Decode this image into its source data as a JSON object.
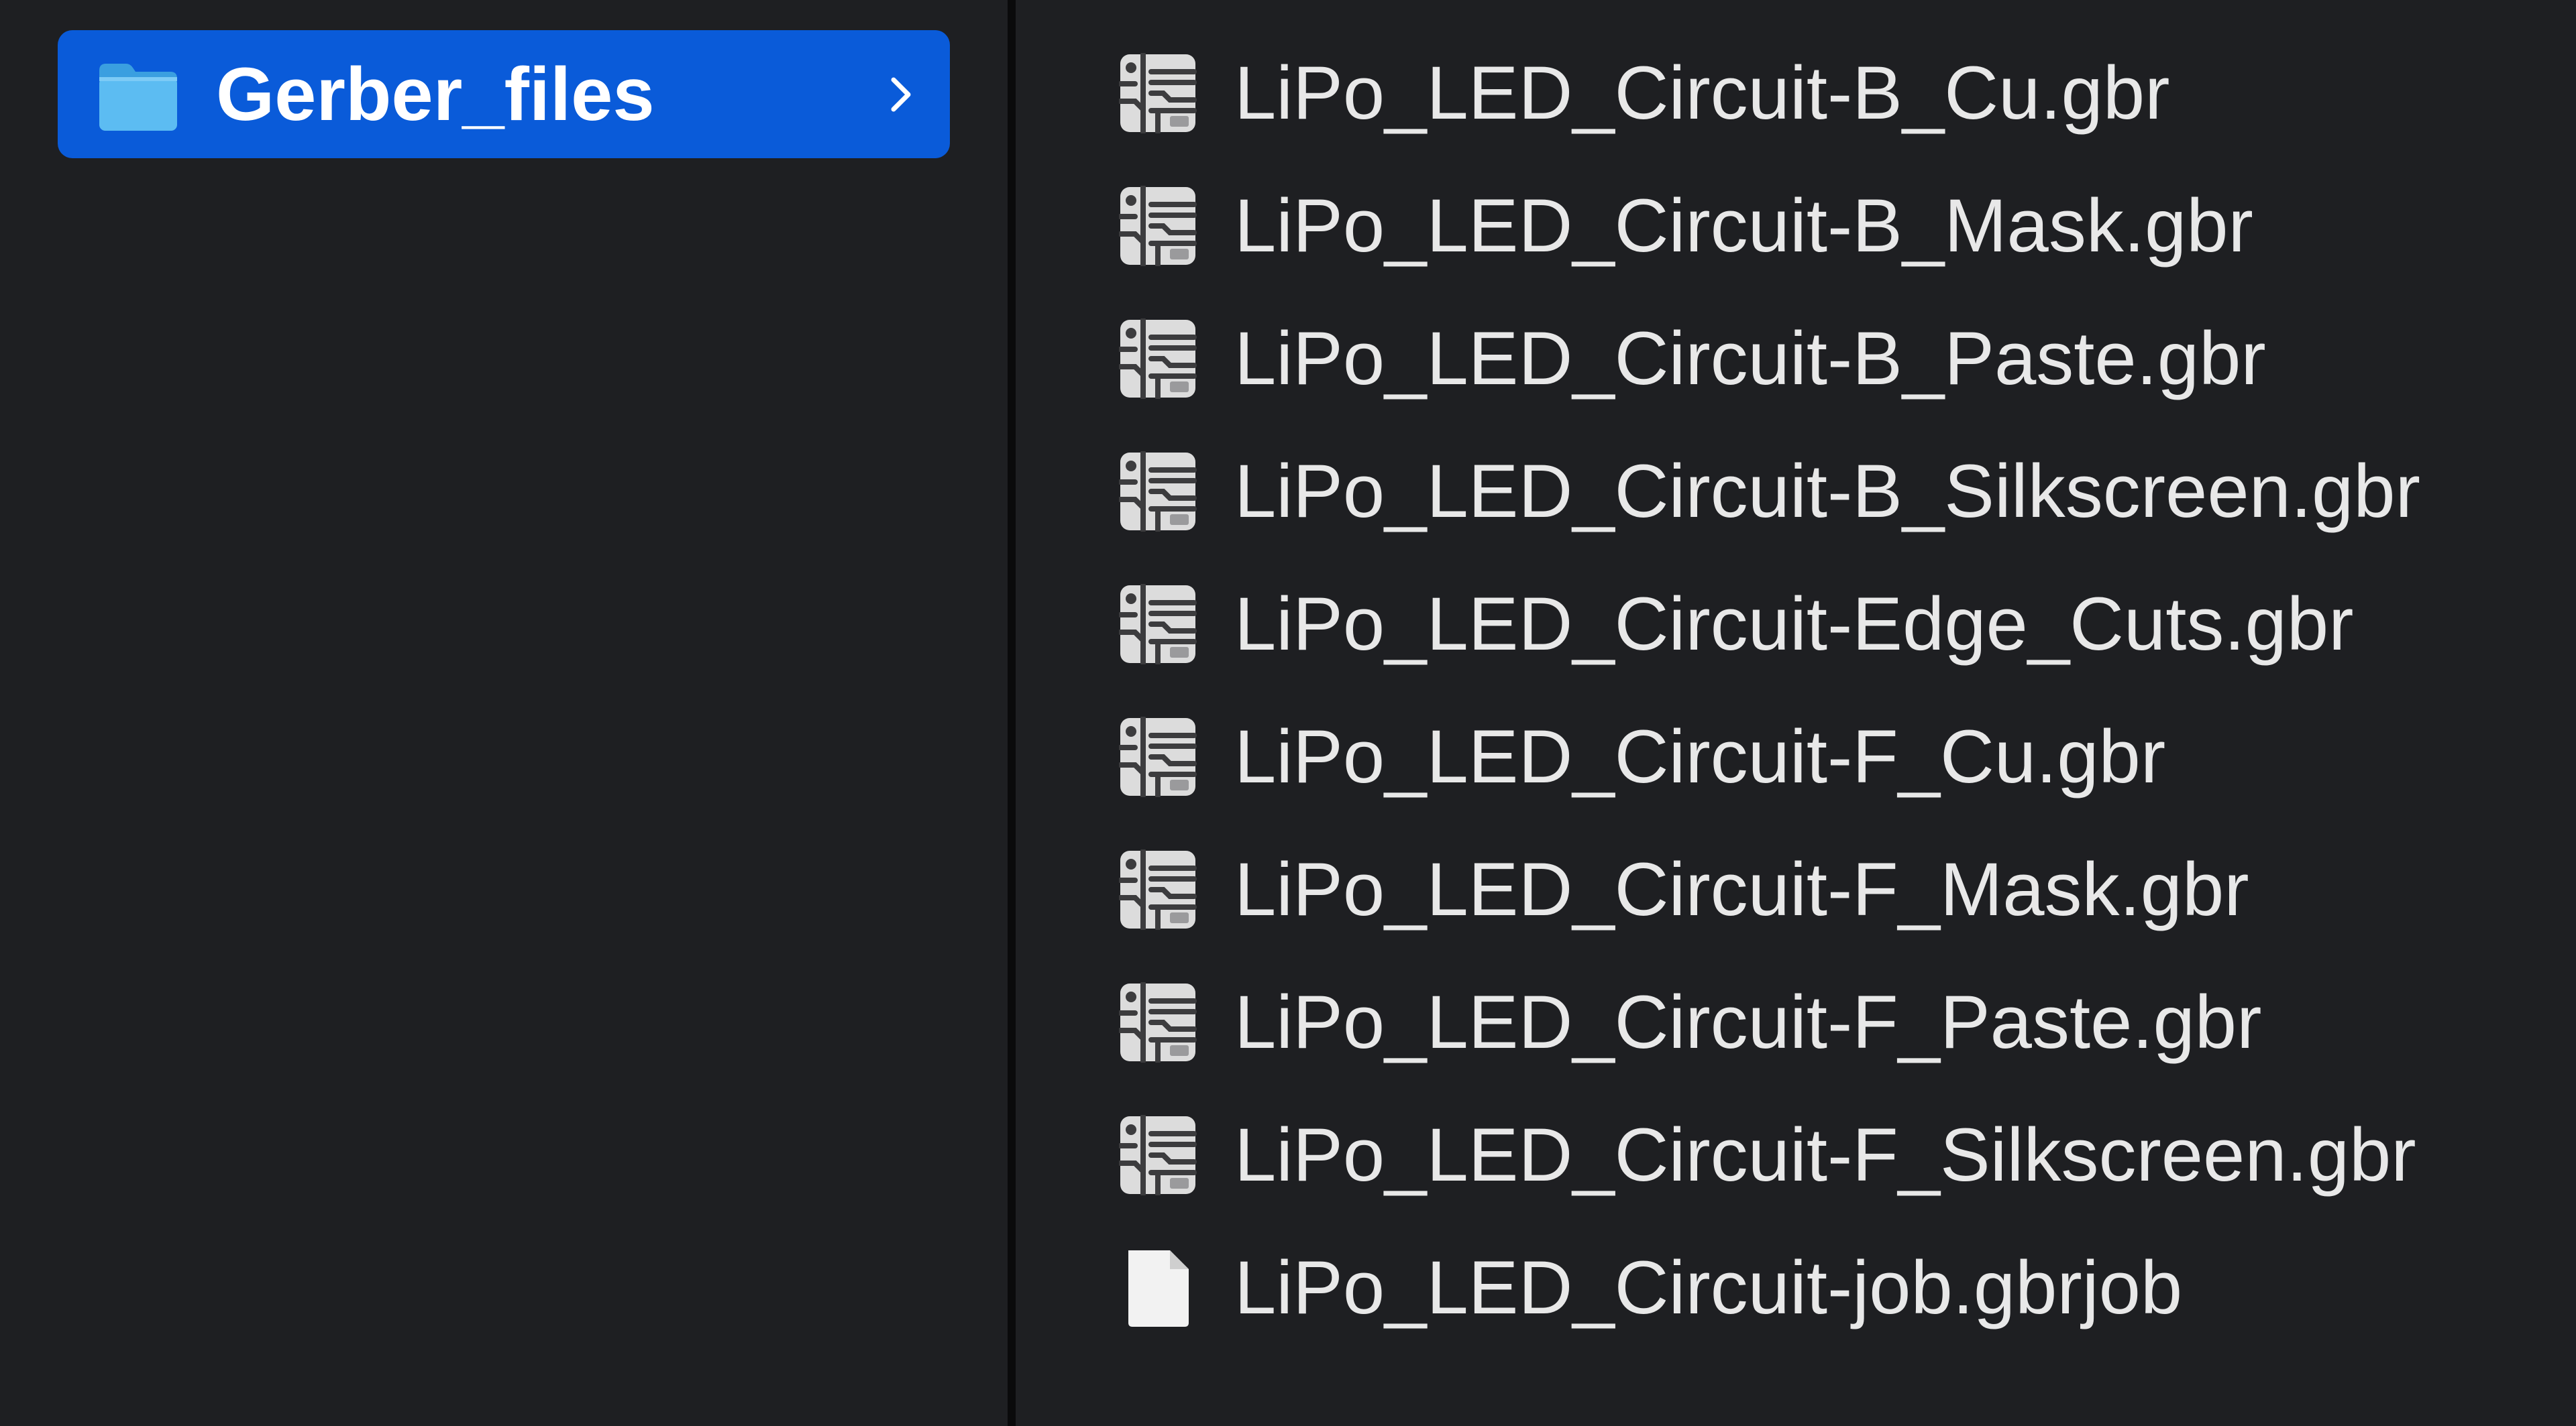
{
  "left_column": {
    "selected_folder": {
      "label": "Gerber_files",
      "icon": "folder-icon",
      "selected": true,
      "has_children_indicator": "chevron-right-icon"
    }
  },
  "right_column": {
    "files": [
      {
        "name": "LiPo_LED_Circuit-B_Cu.gbr",
        "icon": "gerber-file-icon"
      },
      {
        "name": "LiPo_LED_Circuit-B_Mask.gbr",
        "icon": "gerber-file-icon"
      },
      {
        "name": "LiPo_LED_Circuit-B_Paste.gbr",
        "icon": "gerber-file-icon"
      },
      {
        "name": "LiPo_LED_Circuit-B_Silkscreen.gbr",
        "icon": "gerber-file-icon"
      },
      {
        "name": "LiPo_LED_Circuit-Edge_Cuts.gbr",
        "icon": "gerber-file-icon"
      },
      {
        "name": "LiPo_LED_Circuit-F_Cu.gbr",
        "icon": "gerber-file-icon"
      },
      {
        "name": "LiPo_LED_Circuit-F_Mask.gbr",
        "icon": "gerber-file-icon"
      },
      {
        "name": "LiPo_LED_Circuit-F_Paste.gbr",
        "icon": "gerber-file-icon"
      },
      {
        "name": "LiPo_LED_Circuit-F_Silkscreen.gbr",
        "icon": "gerber-file-icon"
      },
      {
        "name": "LiPo_LED_Circuit-job.gbrjob",
        "icon": "document-icon"
      }
    ]
  },
  "colors": {
    "background": "#1e1f22",
    "selection": "#0a5bd9",
    "folder_icon": "#4fb3f0",
    "text": "#e8e8e8",
    "divider": "#0a0a0b"
  }
}
